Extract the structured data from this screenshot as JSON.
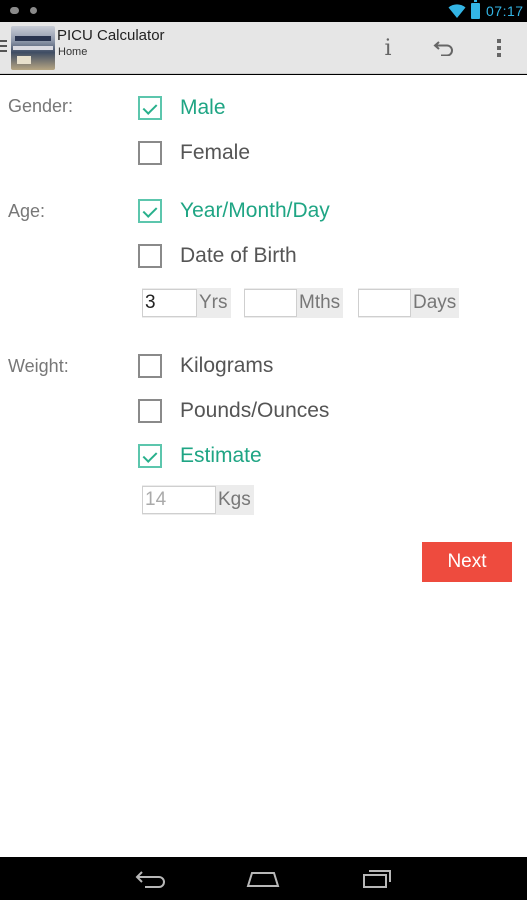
{
  "status_bar": {
    "time": "07:17",
    "accent_color": "#33b5e5",
    "icons": [
      "notification-icon",
      "notification-icon",
      "wifi-icon",
      "battery-charging-icon"
    ]
  },
  "action_bar": {
    "title": "PICU Calculator",
    "subtitle": "Home",
    "info_label": "i",
    "icons": [
      "app-icon",
      "info-icon",
      "undo-icon",
      "overflow-menu-icon"
    ]
  },
  "form": {
    "gender": {
      "label": "Gender:",
      "options": [
        {
          "label": "Male",
          "checked": true
        },
        {
          "label": "Female",
          "checked": false
        }
      ]
    },
    "age": {
      "label": "Age:",
      "options": [
        {
          "label": "Year/Month/Day",
          "checked": true
        },
        {
          "label": "Date of Birth",
          "checked": false
        }
      ],
      "fields": [
        {
          "value": "3",
          "unit": "Yrs"
        },
        {
          "value": "",
          "unit": "Mths"
        },
        {
          "value": "",
          "unit": "Days"
        }
      ]
    },
    "weight": {
      "label": "Weight:",
      "options": [
        {
          "label": "Kilograms",
          "checked": false
        },
        {
          "label": "Pounds/Ounces",
          "checked": false
        },
        {
          "label": "Estimate",
          "checked": true
        }
      ],
      "estimate_field": {
        "value": "14",
        "unit": "Kgs",
        "editable": false
      }
    },
    "next_label": "Next"
  },
  "colors": {
    "checked_accent": "#1fa584",
    "next_button": "#ee4b3e"
  },
  "nav_bar": {
    "icons": [
      "back-nav-icon",
      "home-nav-icon",
      "recents-nav-icon"
    ]
  }
}
